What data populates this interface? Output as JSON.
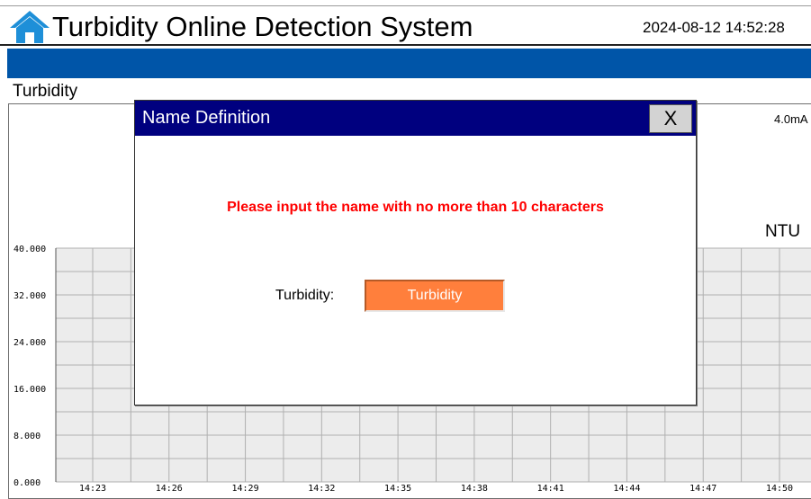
{
  "header": {
    "title": "Turbidity Online Detection System",
    "datetime": "2024-08-12 14:52:28",
    "home_icon": "home-icon",
    "bar_color": "#0055a8"
  },
  "trend": {
    "section_label": "Turbidity",
    "current_label": "4.0mA",
    "unit": "NTU",
    "grid_color": "#b0b0b0",
    "plot_background": "#ececec"
  },
  "chart_data": {
    "type": "line",
    "title": "",
    "xlabel": "",
    "ylabel": "",
    "y_ticks": [
      "40.000",
      "32.000",
      "24.000",
      "16.000",
      "8.000",
      "0.000"
    ],
    "ylim": [
      0,
      40
    ],
    "x_ticks": [
      "14:23",
      "14:26",
      "14:29",
      "14:32",
      "14:35",
      "14:38",
      "14:41",
      "14:44",
      "14:47",
      "14:50"
    ],
    "grid": true,
    "series": []
  },
  "dialog": {
    "title": "Name Definition",
    "close_label": "X",
    "message": "Please input the name with no more than 10 characters",
    "field_label": "Turbidity:",
    "field_value": "Turbidity",
    "field_color": "#ff7f3c",
    "title_color": "#00007f",
    "message_color": "#ff0000"
  }
}
